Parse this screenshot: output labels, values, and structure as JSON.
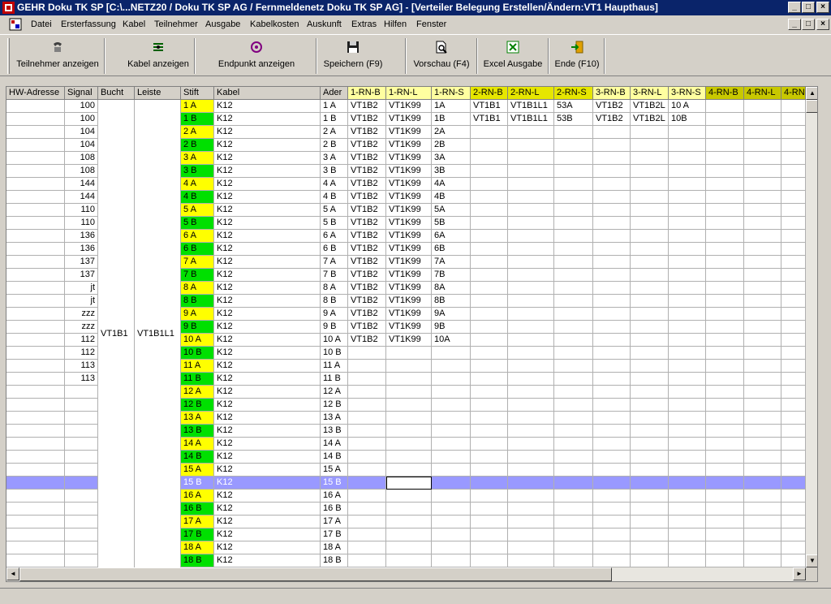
{
  "window": {
    "title": "GEHR Doku TK SP  [C:\\...NETZ20 / Doku TK SP AG / Fernmeldenetz Doku TK SP AG] - [Verteiler Belegung Erstellen/Ändern:VT1 Haupthaus]",
    "min": "_",
    "max": "□",
    "close": "×"
  },
  "menu": {
    "items": [
      "Datei",
      "Ersterfassung",
      "Kabel",
      "Teilnehmer",
      "Ausgabe",
      "Kabelkosten",
      "Auskunft",
      "Extras",
      "Hilfen",
      "Fenster"
    ]
  },
  "toolbar": {
    "buttons": [
      {
        "label": "Teilnehmer anzeigen",
        "icon": "phone-icon"
      },
      {
        "label": "Kabel anzeigen",
        "icon": "cable-icon"
      },
      {
        "label": "Endpunkt anzeigen",
        "icon": "endpoint-icon"
      },
      {
        "label": "Speichern (F9)",
        "icon": "save-icon"
      },
      {
        "label": "Vorschau (F4)",
        "icon": "preview-icon"
      },
      {
        "label": "Excel Ausgabe",
        "icon": "excel-icon"
      },
      {
        "label": "Ende (F10)",
        "icon": "exit-icon"
      }
    ]
  },
  "grid": {
    "columns": [
      "HW-Adresse",
      "Signal",
      "Bucht",
      "Leiste",
      "Stift",
      "Kabel",
      "Ader",
      "1-RN-B",
      "1-RN-L",
      "1-RN-S",
      "2-RN-B",
      "2-RN-L",
      "2-RN-S",
      "3-RN-B",
      "3-RN-L",
      "3-RN-S",
      "4-RN-B",
      "4-RN-L",
      "4-RN"
    ],
    "bucht": "VT1B1",
    "leiste": "VT1B1L1",
    "selected_row": 29,
    "rows": [
      {
        "signal": "100",
        "stift": "1 A",
        "kabel": "K12",
        "ader": "1 A",
        "rn": [
          "VT1B2",
          "VT1K99",
          "1A",
          "VT1B1",
          "VT1B1L1",
          "53A",
          "VT1B2",
          "VT1B2L",
          "10 A",
          "",
          "",
          ""
        ]
      },
      {
        "signal": "100",
        "stift": "1 B",
        "kabel": "K12",
        "ader": "1 B",
        "rn": [
          "VT1B2",
          "VT1K99",
          "1B",
          "VT1B1",
          "VT1B1L1",
          "53B",
          "VT1B2",
          "VT1B2L",
          "10B",
          "",
          "",
          ""
        ]
      },
      {
        "signal": "104",
        "stift": "2 A",
        "kabel": "K12",
        "ader": "2 A",
        "rn": [
          "VT1B2",
          "VT1K99",
          "2A",
          "",
          "",
          "",
          "",
          "",
          "",
          "",
          "",
          ""
        ]
      },
      {
        "signal": "104",
        "stift": "2 B",
        "kabel": "K12",
        "ader": "2 B",
        "rn": [
          "VT1B2",
          "VT1K99",
          "2B",
          "",
          "",
          "",
          "",
          "",
          "",
          "",
          "",
          ""
        ]
      },
      {
        "signal": "108",
        "stift": "3 A",
        "kabel": "K12",
        "ader": "3 A",
        "rn": [
          "VT1B2",
          "VT1K99",
          "3A",
          "",
          "",
          "",
          "",
          "",
          "",
          "",
          "",
          ""
        ]
      },
      {
        "signal": "108",
        "stift": "3 B",
        "kabel": "K12",
        "ader": "3 B",
        "rn": [
          "VT1B2",
          "VT1K99",
          "3B",
          "",
          "",
          "",
          "",
          "",
          "",
          "",
          "",
          ""
        ]
      },
      {
        "signal": "144",
        "stift": "4 A",
        "kabel": "K12",
        "ader": "4 A",
        "rn": [
          "VT1B2",
          "VT1K99",
          "4A",
          "",
          "",
          "",
          "",
          "",
          "",
          "",
          "",
          ""
        ]
      },
      {
        "signal": "144",
        "stift": "4 B",
        "kabel": "K12",
        "ader": "4 B",
        "rn": [
          "VT1B2",
          "VT1K99",
          "4B",
          "",
          "",
          "",
          "",
          "",
          "",
          "",
          "",
          ""
        ]
      },
      {
        "signal": "110",
        "stift": "5 A",
        "kabel": "K12",
        "ader": "5 A",
        "rn": [
          "VT1B2",
          "VT1K99",
          "5A",
          "",
          "",
          "",
          "",
          "",
          "",
          "",
          "",
          ""
        ]
      },
      {
        "signal": "110",
        "stift": "5 B",
        "kabel": "K12",
        "ader": "5 B",
        "rn": [
          "VT1B2",
          "VT1K99",
          "5B",
          "",
          "",
          "",
          "",
          "",
          "",
          "",
          "",
          ""
        ]
      },
      {
        "signal": "136",
        "stift": "6 A",
        "kabel": "K12",
        "ader": "6 A",
        "rn": [
          "VT1B2",
          "VT1K99",
          "6A",
          "",
          "",
          "",
          "",
          "",
          "",
          "",
          "",
          ""
        ]
      },
      {
        "signal": "136",
        "stift": "6 B",
        "kabel": "K12",
        "ader": "6 B",
        "rn": [
          "VT1B2",
          "VT1K99",
          "6B",
          "",
          "",
          "",
          "",
          "",
          "",
          "",
          "",
          ""
        ]
      },
      {
        "signal": "137",
        "stift": "7 A",
        "kabel": "K12",
        "ader": "7 A",
        "rn": [
          "VT1B2",
          "VT1K99",
          "7A",
          "",
          "",
          "",
          "",
          "",
          "",
          "",
          "",
          ""
        ]
      },
      {
        "signal": "137",
        "stift": "7 B",
        "kabel": "K12",
        "ader": "7 B",
        "rn": [
          "VT1B2",
          "VT1K99",
          "7B",
          "",
          "",
          "",
          "",
          "",
          "",
          "",
          "",
          ""
        ]
      },
      {
        "signal": "jt",
        "stift": "8 A",
        "kabel": "K12",
        "ader": "8 A",
        "rn": [
          "VT1B2",
          "VT1K99",
          "8A",
          "",
          "",
          "",
          "",
          "",
          "",
          "",
          "",
          ""
        ]
      },
      {
        "signal": "jt",
        "stift": "8 B",
        "kabel": "K12",
        "ader": "8 B",
        "rn": [
          "VT1B2",
          "VT1K99",
          "8B",
          "",
          "",
          "",
          "",
          "",
          "",
          "",
          "",
          ""
        ]
      },
      {
        "signal": "zzz",
        "stift": "9 A",
        "kabel": "K12",
        "ader": "9 A",
        "rn": [
          "VT1B2",
          "VT1K99",
          "9A",
          "",
          "",
          "",
          "",
          "",
          "",
          "",
          "",
          ""
        ]
      },
      {
        "signal": "zzz",
        "stift": "9 B",
        "kabel": "K12",
        "ader": "9 B",
        "rn": [
          "VT1B2",
          "VT1K99",
          "9B",
          "",
          "",
          "",
          "",
          "",
          "",
          "",
          "",
          ""
        ]
      },
      {
        "signal": "112",
        "stift": "10 A",
        "kabel": "K12",
        "ader": "10 A",
        "rn": [
          "VT1B2",
          "VT1K99",
          "10A",
          "",
          "",
          "",
          "",
          "",
          "",
          "",
          "",
          ""
        ]
      },
      {
        "signal": "112",
        "stift": "10 B",
        "kabel": "K12",
        "ader": "10 B",
        "rn": [
          "",
          "",
          "",
          "",
          "",
          "",
          "",
          "",
          "",
          "",
          "",
          ""
        ]
      },
      {
        "signal": "113",
        "stift": "11 A",
        "kabel": "K12",
        "ader": "11 A",
        "rn": [
          "",
          "",
          "",
          "",
          "",
          "",
          "",
          "",
          "",
          "",
          "",
          ""
        ]
      },
      {
        "signal": "113",
        "stift": "11 B",
        "kabel": "K12",
        "ader": "11 B",
        "rn": [
          "",
          "",
          "",
          "",
          "",
          "",
          "",
          "",
          "",
          "",
          "",
          ""
        ]
      },
      {
        "signal": "",
        "stift": "12 A",
        "kabel": "K12",
        "ader": "12 A",
        "rn": [
          "",
          "",
          "",
          "",
          "",
          "",
          "",
          "",
          "",
          "",
          "",
          ""
        ]
      },
      {
        "signal": "",
        "stift": "12 B",
        "kabel": "K12",
        "ader": "12 B",
        "rn": [
          "",
          "",
          "",
          "",
          "",
          "",
          "",
          "",
          "",
          "",
          "",
          ""
        ]
      },
      {
        "signal": "",
        "stift": "13 A",
        "kabel": "K12",
        "ader": "13 A",
        "rn": [
          "",
          "",
          "",
          "",
          "",
          "",
          "",
          "",
          "",
          "",
          "",
          ""
        ]
      },
      {
        "signal": "",
        "stift": "13 B",
        "kabel": "K12",
        "ader": "13 B",
        "rn": [
          "",
          "",
          "",
          "",
          "",
          "",
          "",
          "",
          "",
          "",
          "",
          ""
        ]
      },
      {
        "signal": "",
        "stift": "14 A",
        "kabel": "K12",
        "ader": "14 A",
        "rn": [
          "",
          "",
          "",
          "",
          "",
          "",
          "",
          "",
          "",
          "",
          "",
          ""
        ]
      },
      {
        "signal": "",
        "stift": "14 B",
        "kabel": "K12",
        "ader": "14 B",
        "rn": [
          "",
          "",
          "",
          "",
          "",
          "",
          "",
          "",
          "",
          "",
          "",
          ""
        ]
      },
      {
        "signal": "",
        "stift": "15 A",
        "kabel": "K12",
        "ader": "15 A",
        "rn": [
          "",
          "",
          "",
          "",
          "",
          "",
          "",
          "",
          "",
          "",
          "",
          ""
        ]
      },
      {
        "signal": "",
        "stift": "15 B",
        "kabel": "K12",
        "ader": "15 B",
        "rn": [
          "",
          "",
          "",
          "",
          "",
          "",
          "",
          "",
          "",
          "",
          "",
          ""
        ]
      },
      {
        "signal": "",
        "stift": "16 A",
        "kabel": "K12",
        "ader": "16 A",
        "rn": [
          "",
          "",
          "",
          "",
          "",
          "",
          "",
          "",
          "",
          "",
          "",
          ""
        ]
      },
      {
        "signal": "",
        "stift": "16 B",
        "kabel": "K12",
        "ader": "16 B",
        "rn": [
          "",
          "",
          "",
          "",
          "",
          "",
          "",
          "",
          "",
          "",
          "",
          ""
        ]
      },
      {
        "signal": "",
        "stift": "17 A",
        "kabel": "K12",
        "ader": "17 A",
        "rn": [
          "",
          "",
          "",
          "",
          "",
          "",
          "",
          "",
          "",
          "",
          "",
          ""
        ]
      },
      {
        "signal": "",
        "stift": "17 B",
        "kabel": "K12",
        "ader": "17 B",
        "rn": [
          "",
          "",
          "",
          "",
          "",
          "",
          "",
          "",
          "",
          "",
          "",
          ""
        ]
      },
      {
        "signal": "",
        "stift": "18 A",
        "kabel": "K12",
        "ader": "18 A",
        "rn": [
          "",
          "",
          "",
          "",
          "",
          "",
          "",
          "",
          "",
          "",
          "",
          ""
        ]
      },
      {
        "signal": "",
        "stift": "18 B",
        "kabel": "K12",
        "ader": "18 B",
        "rn": [
          "",
          "",
          "",
          "",
          "",
          "",
          "",
          "",
          "",
          "",
          "",
          ""
        ]
      }
    ]
  },
  "colors": {
    "titlebar": "#0a246a",
    "stift_a": "#ffff00",
    "stift_b": "#00e000",
    "selection": "#9999ff"
  },
  "scroll": {
    "up": "▲",
    "down": "▼",
    "left": "◄",
    "right": "►"
  }
}
